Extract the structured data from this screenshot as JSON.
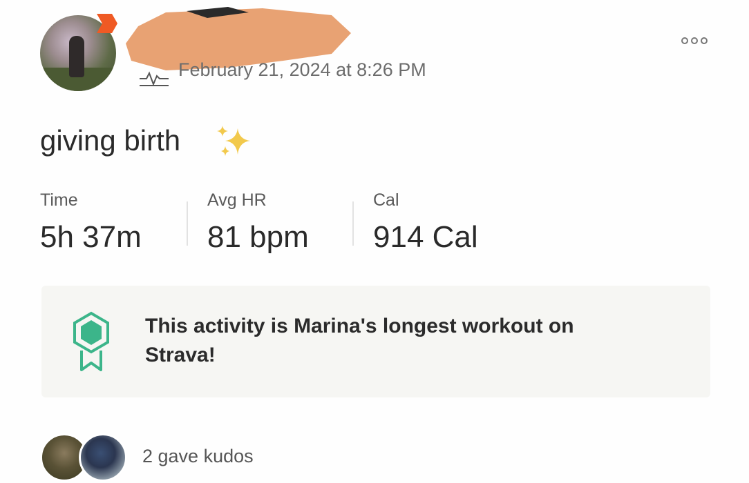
{
  "post": {
    "timestamp": "February 21, 2024 at 8:26 PM",
    "title": "giving birth",
    "title_emoji": "✨"
  },
  "stats": [
    {
      "label": "Time",
      "value": "5h 37m"
    },
    {
      "label": "Avg HR",
      "value": "81 bpm"
    },
    {
      "label": "Cal",
      "value": "914 Cal"
    }
  ],
  "achievement": {
    "text": "This activity is Marina's longest workout on Strava!",
    "icon": "award-ribbon-icon",
    "accent_color": "#3cb58a"
  },
  "kudos": {
    "text": "2 gave kudos"
  },
  "colors": {
    "brand_orange": "#fc4c02",
    "redaction": "#e8a273"
  }
}
